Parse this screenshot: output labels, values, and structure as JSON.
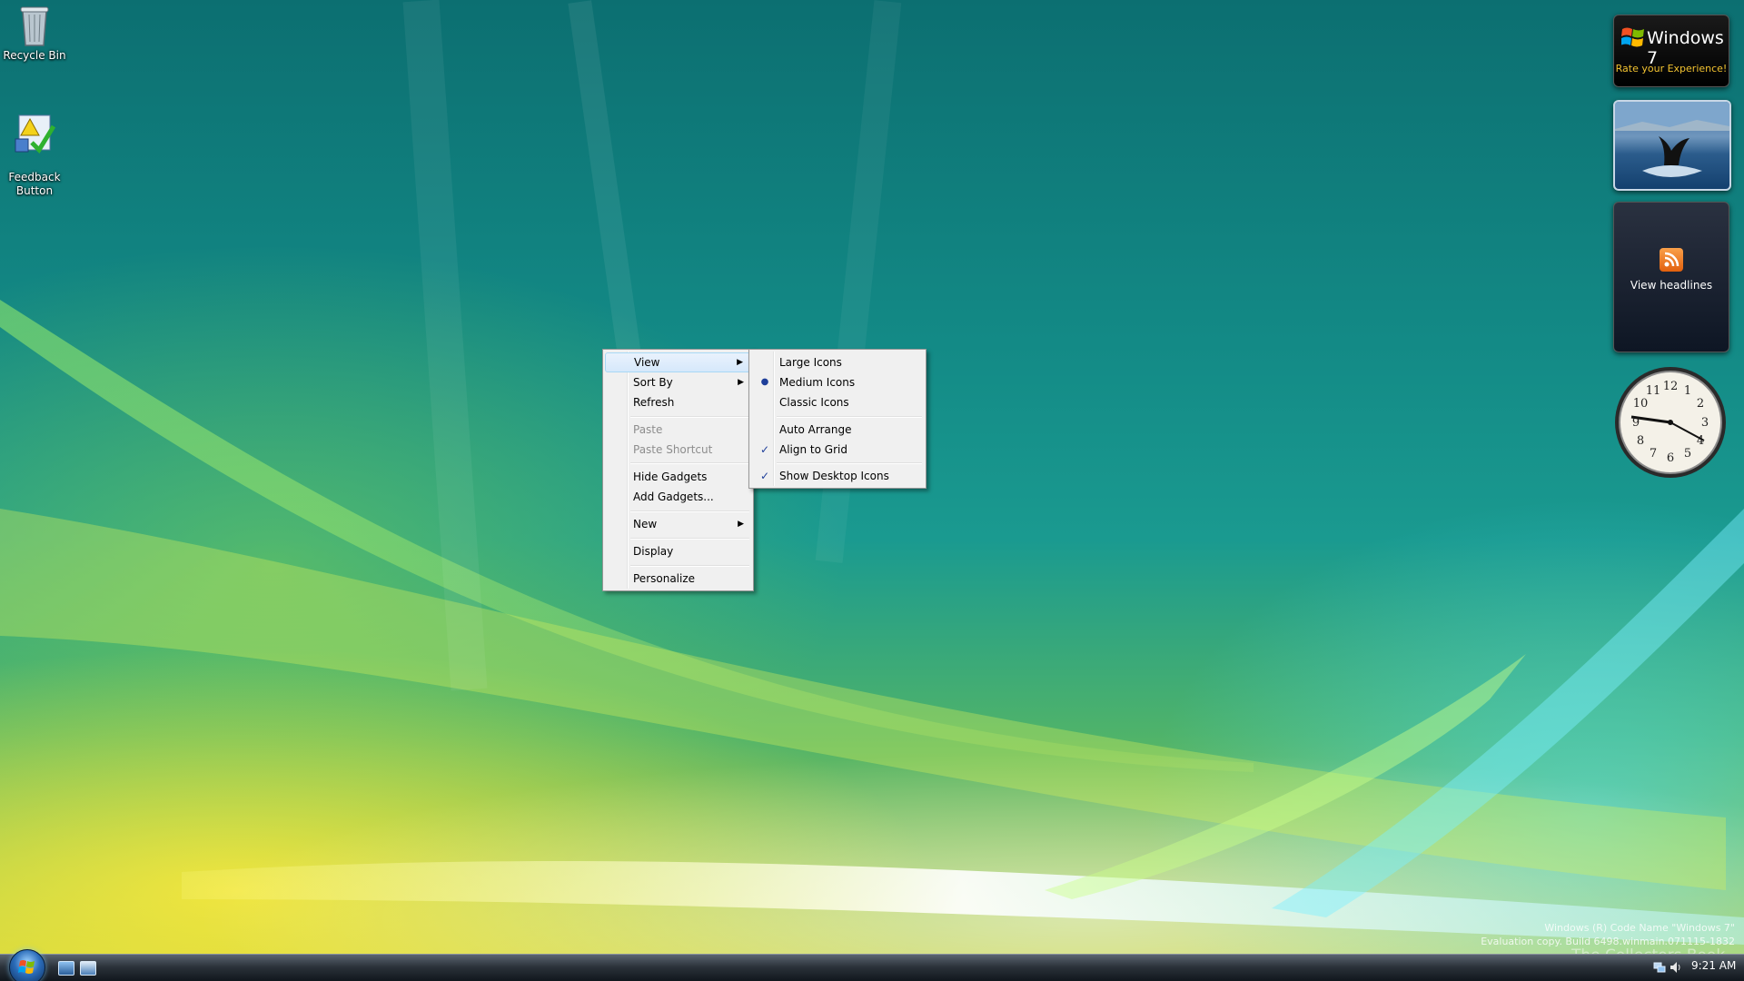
{
  "desktop": {
    "icons": [
      {
        "label": "Recycle Bin"
      },
      {
        "label": "Feedback\nButton"
      }
    ]
  },
  "gadgets": {
    "win7": {
      "title": "Windows 7",
      "subtitle": "Rate your Experience!"
    },
    "feed": {
      "label": "View headlines"
    },
    "clock": {
      "numbers": [
        "12",
        "1",
        "2",
        "3",
        "4",
        "5",
        "6",
        "7",
        "8",
        "9",
        "10",
        "11"
      ]
    }
  },
  "context_menu": {
    "items": [
      {
        "label": "View",
        "submenu": true,
        "hot": true
      },
      {
        "label": "Sort By",
        "submenu": true
      },
      {
        "label": "Refresh"
      },
      {
        "label": "Paste",
        "disabled": true
      },
      {
        "label": "Paste Shortcut",
        "disabled": true
      },
      {
        "label": "Hide Gadgets"
      },
      {
        "label": "Add Gadgets..."
      },
      {
        "label": "New",
        "submenu": true
      },
      {
        "label": "Display"
      },
      {
        "label": "Personalize"
      }
    ]
  },
  "view_submenu": {
    "items": [
      {
        "label": "Large Icons"
      },
      {
        "label": "Medium Icons",
        "mark": "radio"
      },
      {
        "label": "Classic Icons"
      },
      {
        "label": "Auto Arrange"
      },
      {
        "label": "Align to Grid",
        "mark": "check"
      },
      {
        "label": "Show Desktop Icons",
        "mark": "check"
      }
    ]
  },
  "watermark": {
    "line1": "Windows (R) Code Name \"Windows 7\"",
    "line2": "Evaluation copy. Build 6498.winmain.071115-1832",
    "collectors": "The Collectors Book"
  },
  "taskbar": {
    "time": "9:21 AM",
    "arrow_glyph": "▶",
    "check_glyph": "✓",
    "radio_glyph": "●"
  }
}
